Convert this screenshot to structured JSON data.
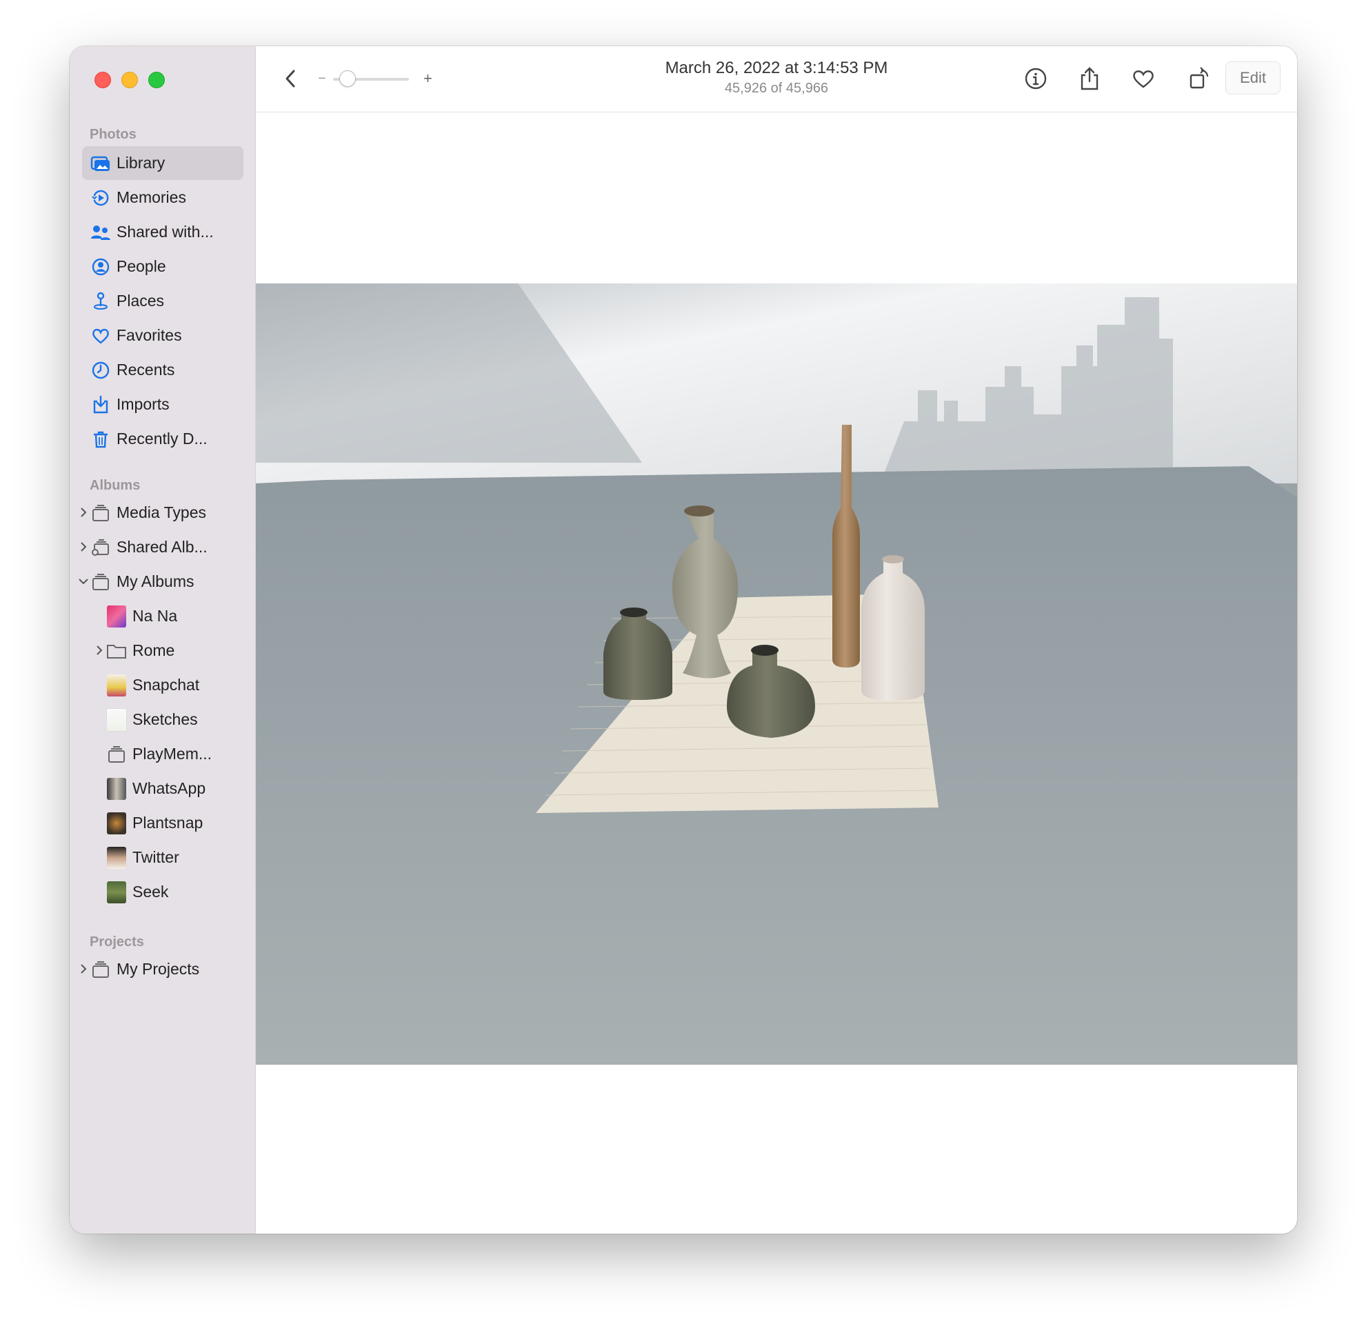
{
  "window": {
    "title": "March 26, 2022 at 3:14:53 PM",
    "subtitle": "45,926 of 45,966"
  },
  "toolbar": {
    "edit_label": "Edit",
    "zoom_minus": "−",
    "zoom_plus": "+",
    "zoom_level": 0.15
  },
  "sidebar": {
    "photos_title": "Photos",
    "albums_title": "Albums",
    "projects_title": "Projects",
    "photos_items": [
      {
        "label": "Library",
        "icon": "library-icon",
        "active": true
      },
      {
        "label": "Memories",
        "icon": "memories-icon"
      },
      {
        "label": "Shared with...",
        "icon": "shared-with-you-icon"
      },
      {
        "label": "People",
        "icon": "people-icon"
      },
      {
        "label": "Places",
        "icon": "places-icon"
      },
      {
        "label": "Favorites",
        "icon": "heart-icon"
      },
      {
        "label": "Recents",
        "icon": "clock-icon"
      },
      {
        "label": "Imports",
        "icon": "import-icon"
      },
      {
        "label": "Recently D...",
        "icon": "trash-icon"
      }
    ],
    "album_items": [
      {
        "label": "Media Types",
        "icon": "album-stack-icon",
        "disclosure": "collapsed"
      },
      {
        "label": "Shared Alb...",
        "icon": "shared-album-icon",
        "disclosure": "collapsed"
      },
      {
        "label": "My Albums",
        "icon": "album-stack-icon",
        "disclosure": "expanded"
      },
      {
        "label": "Na Na",
        "icon": "album-thumbnail"
      },
      {
        "label": "Rome",
        "icon": "folder-icon",
        "disclosure": "collapsed"
      },
      {
        "label": "Snapchat",
        "icon": "album-thumbnail"
      },
      {
        "label": "Sketches",
        "icon": "album-thumbnail"
      },
      {
        "label": "PlayMem...",
        "icon": "album-stack-icon"
      },
      {
        "label": "WhatsApp",
        "icon": "album-thumbnail"
      },
      {
        "label": "Plantsnap",
        "icon": "album-thumbnail"
      },
      {
        "label": "Twitter",
        "icon": "album-thumbnail"
      },
      {
        "label": "Seek",
        "icon": "album-thumbnail"
      }
    ],
    "project_items": [
      {
        "label": "My Projects",
        "icon": "album-stack-icon",
        "disclosure": "collapsed"
      }
    ]
  },
  "colors": {
    "accent": "#1a73e8",
    "sidebar_bg": "#e6e1e6",
    "selection_bg": "#d3cfd4"
  }
}
